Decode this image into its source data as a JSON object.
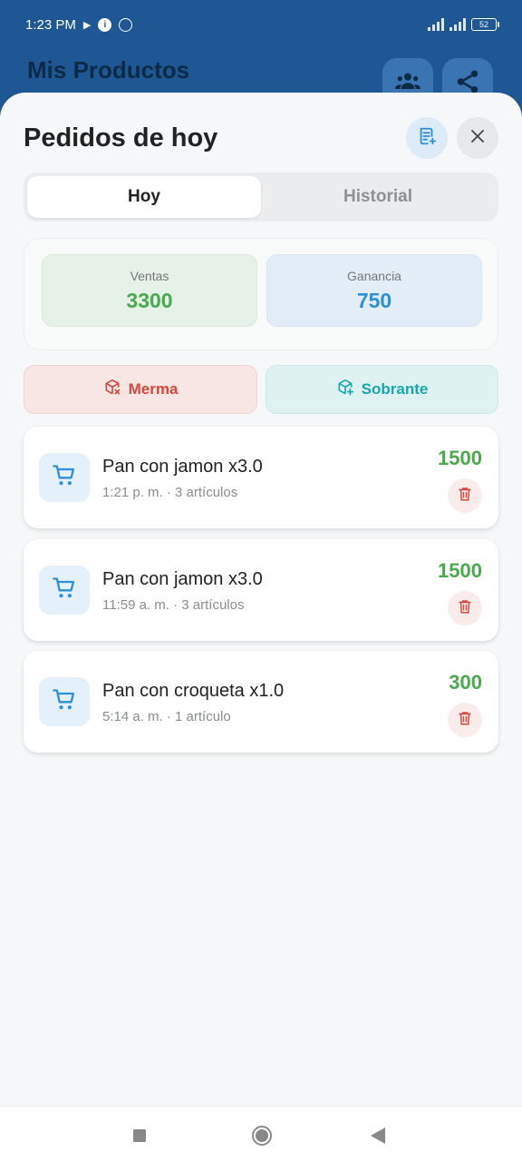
{
  "status_bar": {
    "time": "1:23 PM",
    "battery": "52"
  },
  "app": {
    "title": "Mis Productos"
  },
  "sheet": {
    "title": "Pedidos de hoy",
    "tabs": [
      {
        "label": "Hoy",
        "active": true
      },
      {
        "label": "Historial",
        "active": false
      }
    ],
    "summary": {
      "ventas_label": "Ventas",
      "ventas_value": "3300",
      "ganancia_label": "Ganancia",
      "ganancia_value": "750"
    },
    "actions": {
      "merma": "Merma",
      "sobrante": "Sobrante"
    },
    "orders": [
      {
        "name": "Pan con jamon x3.0",
        "meta": "1:21 p. m. · 3 artículos",
        "total": "1500"
      },
      {
        "name": "Pan con jamon x3.0",
        "meta": "11:59 a. m. · 3 artículos",
        "total": "1500"
      },
      {
        "name": "Pan con croqueta x1.0",
        "meta": "5:14 a. m. · 1 artículo",
        "total": "300"
      }
    ]
  },
  "colors": {
    "header_bg": "#1e5793",
    "ventas": "#4aa84e",
    "ganancia": "#2e8fd8",
    "merma": "#d9473c",
    "sobrante": "#17a8ad",
    "cart": "#2e8fd8",
    "delete": "#d9473c"
  },
  "icons": {
    "status": [
      "play-icon",
      "info-icon",
      "circle-icon",
      "signal-icon",
      "battery-icon"
    ],
    "header": [
      "group-icon",
      "share-icon"
    ],
    "sheet": [
      "add-list-icon",
      "close-icon",
      "merma-box-icon",
      "sobrante-box-icon",
      "cart-icon",
      "trash-icon"
    ],
    "nav": [
      "recents-icon",
      "home-icon",
      "back-icon"
    ]
  }
}
